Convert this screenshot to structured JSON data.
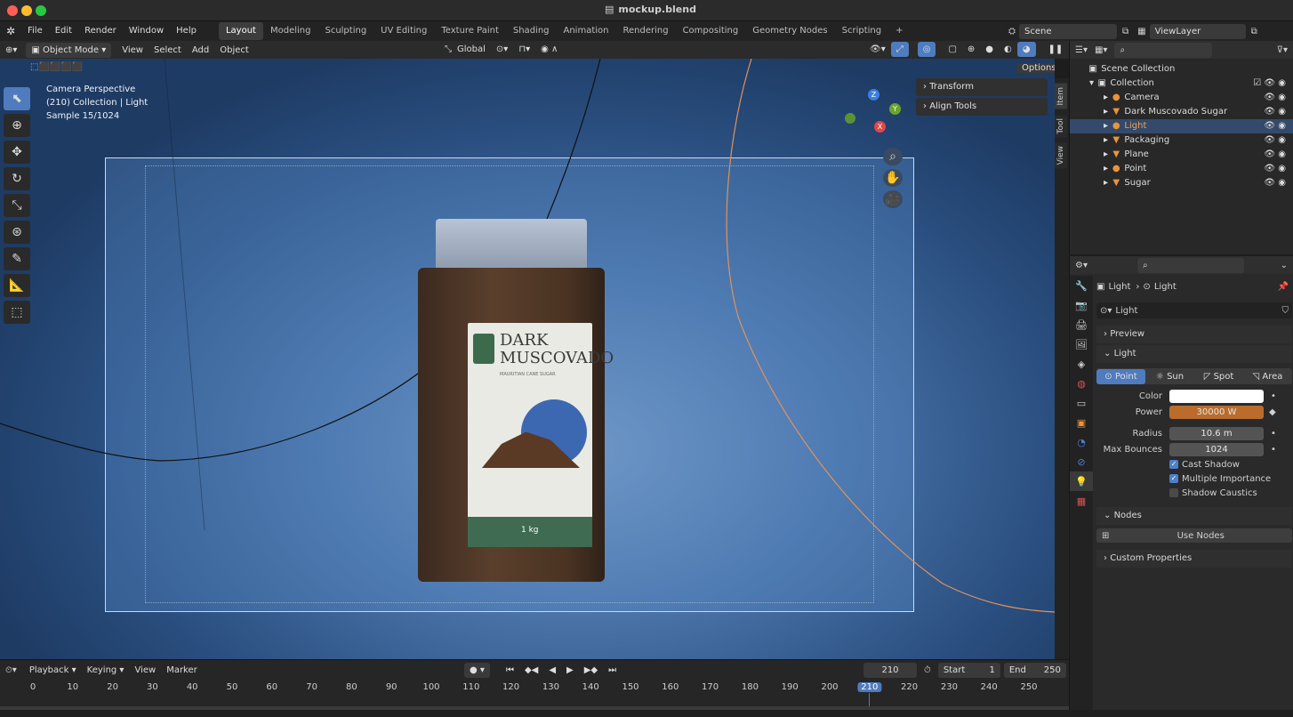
{
  "window": {
    "title": "mockup.blend"
  },
  "menu": [
    "File",
    "Edit",
    "Render",
    "Window",
    "Help"
  ],
  "workspaces": [
    "Layout",
    "Modeling",
    "Sculpting",
    "UV Editing",
    "Texture Paint",
    "Shading",
    "Animation",
    "Rendering",
    "Compositing",
    "Geometry Nodes",
    "Scripting"
  ],
  "active_workspace": "Layout",
  "scene": {
    "label": "Scene",
    "view_layer": "ViewLayer"
  },
  "header": {
    "mode": "Object Mode",
    "menus": [
      "View",
      "Select",
      "Add",
      "Object"
    ],
    "transform": "Global",
    "options": "Options"
  },
  "viewport": {
    "info": [
      "Camera Perspective",
      "(210) Collection | Light",
      "Sample 15/1024"
    ],
    "npanel": [
      "Transform",
      "Align Tools"
    ],
    "side_tabs": [
      "Item",
      "Tool",
      "View"
    ],
    "gizmo": {
      "z": "Z",
      "y": "Y",
      "x": "X"
    },
    "product": {
      "title1": "DARK",
      "title2": "MUSCOVADO",
      "subtitle": "MAURITIAN CANE SUGAR",
      "weight": "1 kg"
    }
  },
  "outliner": {
    "root": "Scene Collection",
    "collection": "Collection",
    "items": [
      "Camera",
      "Dark Muscovado Sugar",
      "Light",
      "Packaging",
      "Plane",
      "Point",
      "Sugar"
    ],
    "selected": "Light"
  },
  "properties": {
    "breadcrumb": [
      "Light",
      "Light"
    ],
    "datablock": "Light",
    "sections": {
      "preview": "Preview",
      "light": "Light",
      "nodes": "Nodes",
      "custom": "Custom Properties"
    },
    "types": [
      "Point",
      "Sun",
      "Spot",
      "Area"
    ],
    "active_type": "Point",
    "color_label": "Color",
    "color": "#ffffff",
    "power_label": "Power",
    "power": "30000 W",
    "power_color": "#b96c2c",
    "radius_label": "Radius",
    "radius": "10.6 m",
    "bounces_label": "Max Bounces",
    "bounces": "1024",
    "cast_shadow": "Cast Shadow",
    "multiple_importance": "Multiple Importance",
    "shadow_caustics": "Shadow Caustics",
    "use_nodes": "Use Nodes"
  },
  "timeline": {
    "menus": [
      "Playback",
      "Keying",
      "View",
      "Marker"
    ],
    "current_frame": "210",
    "start_label": "Start",
    "start": "1",
    "end_label": "End",
    "end": "250",
    "ticks": [
      "0",
      "10",
      "20",
      "30",
      "40",
      "50",
      "60",
      "70",
      "80",
      "90",
      "100",
      "110",
      "120",
      "130",
      "140",
      "150",
      "160",
      "170",
      "180",
      "190",
      "200",
      "210",
      "220",
      "230",
      "240",
      "250"
    ]
  },
  "colors": {
    "accent": "#4f7bbf",
    "selected_row": "#334a6b"
  }
}
